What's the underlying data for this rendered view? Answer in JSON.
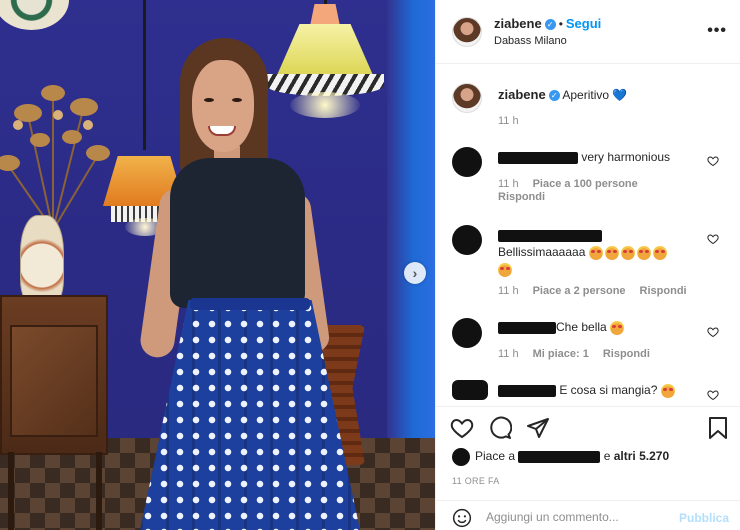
{
  "post": {
    "username": "ziabene",
    "follow_label": "Segui",
    "location": "Dabass Milano",
    "more_label": "•••"
  },
  "caption": {
    "username": "ziabene",
    "text": "Aperitivo",
    "heart_emoji": "💙",
    "time": "11 h"
  },
  "comments": [
    {
      "text": "very harmonious",
      "time": "11 h",
      "likes": "Piace a 100 persone",
      "reply": "Rispondi"
    },
    {
      "text": "Bellissimaaaaaa",
      "time": "11 h",
      "likes": "Piace a 2 persone",
      "reply": "Rispondi"
    },
    {
      "text": "Che bella",
      "time": "11 h",
      "likes": "Mi piace: 1",
      "reply": "Rispondi"
    },
    {
      "text": "E cosa si mangia?",
      "time": "",
      "likes": "",
      "reply": ""
    }
  ],
  "likes_bar": {
    "prefix": "Piace a",
    "suffix": "e",
    "others": "altri 5.270"
  },
  "timestamp": "11 ORE FA",
  "add_comment": {
    "placeholder": "Aggiungi un commento...",
    "publish_label": "Pubblica"
  },
  "colors": {
    "accent": "#0095f6",
    "verified": "#3897f0",
    "text_primary": "#262626",
    "text_secondary": "#8e8e8e",
    "publish_disabled": "#b2dffc"
  },
  "icons": [
    "chevron-right-icon",
    "verified-badge-icon",
    "more-icon",
    "heart-icon",
    "comment-icon",
    "share-icon",
    "bookmark-icon",
    "smiley-icon"
  ]
}
